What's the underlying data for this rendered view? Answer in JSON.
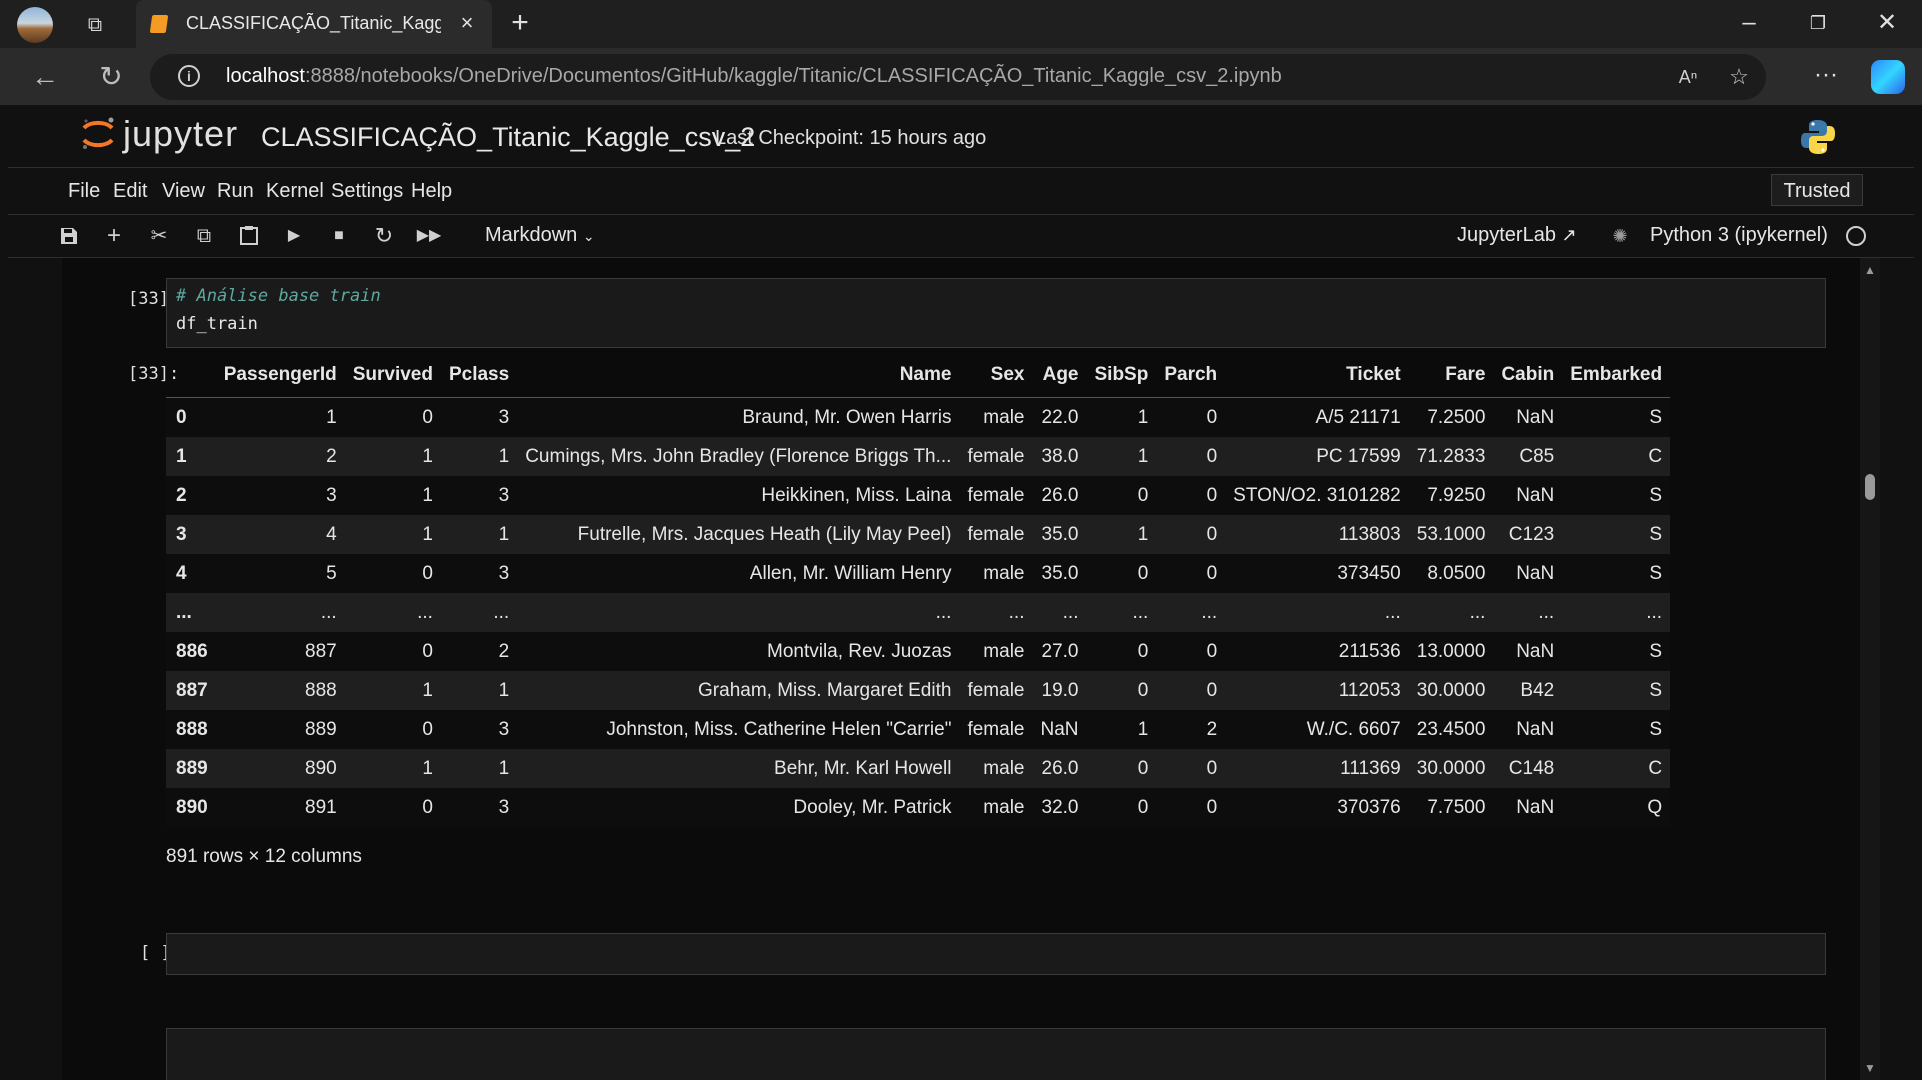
{
  "browser": {
    "tab_title": "CLASSIFICAÇÃO_Titanic_Kaggle_",
    "url_host": "localhost",
    "url_rest": ":8888/notebooks/OneDrive/Documentos/GitHub/kaggle/Titanic/CLASSIFICAÇÃO_Titanic_Kaggle_csv_2.ipynb"
  },
  "jupyter": {
    "wordmark": "jupyter",
    "notebook_title": "CLASSIFICAÇÃO_Titanic_Kaggle_csv_2",
    "checkpoint": "Last Checkpoint: 15 hours ago",
    "menu": [
      "File",
      "Edit",
      "View",
      "Run",
      "Kernel",
      "Settings",
      "Help"
    ],
    "trusted": "Trusted",
    "cell_type": "Markdown",
    "jupyterlab_link": "JupyterLab",
    "kernel": "Python 3 (ipykernel)"
  },
  "cells": {
    "input_prompt": "[33]:",
    "output_prompt": "[33]:",
    "code_comment": "# Análise base train",
    "code": "df_train",
    "empty_prompt": "[ ]:"
  },
  "dataframe": {
    "columns": [
      "",
      "PassengerId",
      "Survived",
      "Pclass",
      "Name",
      "Sex",
      "Age",
      "SibSp",
      "Parch",
      "Ticket",
      "Fare",
      "Cabin",
      "Embarked"
    ],
    "rows": [
      [
        "0",
        "1",
        "0",
        "3",
        "Braund, Mr. Owen Harris",
        "male",
        "22.0",
        "1",
        "0",
        "A/5 21171",
        "7.2500",
        "NaN",
        "S"
      ],
      [
        "1",
        "2",
        "1",
        "1",
        "Cumings, Mrs. John Bradley (Florence Briggs Th...",
        "female",
        "38.0",
        "1",
        "0",
        "PC 17599",
        "71.2833",
        "C85",
        "C"
      ],
      [
        "2",
        "3",
        "1",
        "3",
        "Heikkinen, Miss. Laina",
        "female",
        "26.0",
        "0",
        "0",
        "STON/O2. 3101282",
        "7.9250",
        "NaN",
        "S"
      ],
      [
        "3",
        "4",
        "1",
        "1",
        "Futrelle, Mrs. Jacques Heath (Lily May Peel)",
        "female",
        "35.0",
        "1",
        "0",
        "113803",
        "53.1000",
        "C123",
        "S"
      ],
      [
        "4",
        "5",
        "0",
        "3",
        "Allen, Mr. William Henry",
        "male",
        "35.0",
        "0",
        "0",
        "373450",
        "8.0500",
        "NaN",
        "S"
      ],
      [
        "...",
        "...",
        "...",
        "...",
        "...",
        "...",
        "...",
        "...",
        "...",
        "...",
        "...",
        "...",
        "..."
      ],
      [
        "886",
        "887",
        "0",
        "2",
        "Montvila, Rev. Juozas",
        "male",
        "27.0",
        "0",
        "0",
        "211536",
        "13.0000",
        "NaN",
        "S"
      ],
      [
        "887",
        "888",
        "1",
        "1",
        "Graham, Miss. Margaret Edith",
        "female",
        "19.0",
        "0",
        "0",
        "112053",
        "30.0000",
        "B42",
        "S"
      ],
      [
        "888",
        "889",
        "0",
        "3",
        "Johnston, Miss. Catherine Helen \"Carrie\"",
        "female",
        "NaN",
        "1",
        "2",
        "W./C. 6607",
        "23.4500",
        "NaN",
        "S"
      ],
      [
        "889",
        "890",
        "1",
        "1",
        "Behr, Mr. Karl Howell",
        "male",
        "26.0",
        "0",
        "0",
        "111369",
        "30.0000",
        "C148",
        "C"
      ],
      [
        "890",
        "891",
        "0",
        "3",
        "Dooley, Mr. Patrick",
        "male",
        "32.0",
        "0",
        "0",
        "370376",
        "7.7500",
        "NaN",
        "Q"
      ]
    ],
    "summary": "891 rows × 12 columns"
  },
  "icons": {
    "toolbar": [
      "save-icon",
      "add-cell-icon",
      "cut-icon",
      "copy-icon",
      "paste-icon",
      "run-icon",
      "stop-icon",
      "restart-icon",
      "run-all-icon"
    ]
  }
}
